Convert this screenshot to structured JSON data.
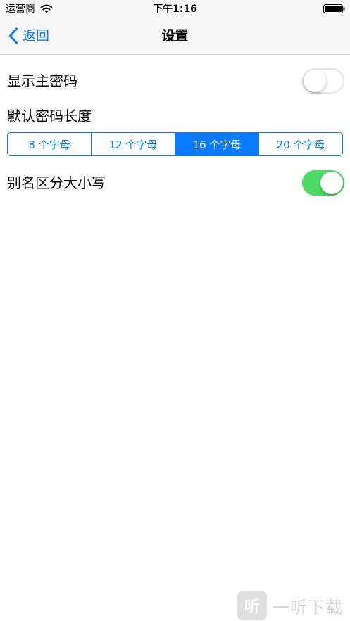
{
  "status_bar": {
    "carrier": "运营商",
    "time": "下午1:16"
  },
  "nav": {
    "back_label": "返回",
    "title": "设置"
  },
  "settings": {
    "show_master_password": {
      "label": "显示主密码",
      "on": false
    },
    "default_length": {
      "label": "默认密码长度",
      "options": [
        "8 个字母",
        "12 个字母",
        "16 个字母",
        "20 个字母"
      ],
      "selected": "16 个字母"
    },
    "alias_case_sensitive": {
      "label": "别名区分大小写",
      "on": true
    }
  },
  "watermark": {
    "badge": "听",
    "text": "一听下载"
  },
  "colors": {
    "accent": "#0a7aff",
    "toggle_on": "#4cd964"
  },
  "icons": {
    "wifi": "wifi-icon",
    "battery": "battery-icon",
    "back": "chevron-left-icon"
  }
}
